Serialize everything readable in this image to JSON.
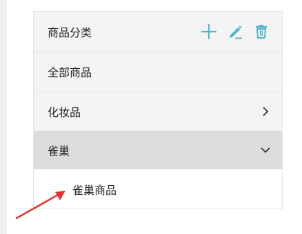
{
  "category_panel": {
    "header": {
      "title": "商品分类",
      "actions": [
        {
          "icon": "plus-icon",
          "color": "#4fb6cf"
        },
        {
          "icon": "pencil-icon",
          "color": "#4fb6cf"
        },
        {
          "icon": "trash-icon",
          "color": "#4fb6cf"
        }
      ]
    },
    "items": [
      {
        "label": "全部商品",
        "chevron": null
      },
      {
        "label": "化妆品",
        "chevron": "chevron-right-icon"
      },
      {
        "label": "雀巢",
        "chevron": "chevron-down-icon",
        "selected": true
      },
      {
        "label": "雀巢商品",
        "parent": "雀巢"
      }
    ]
  },
  "annotation": {
    "icon": "red-arrow-icon",
    "color": "#e3322b"
  }
}
